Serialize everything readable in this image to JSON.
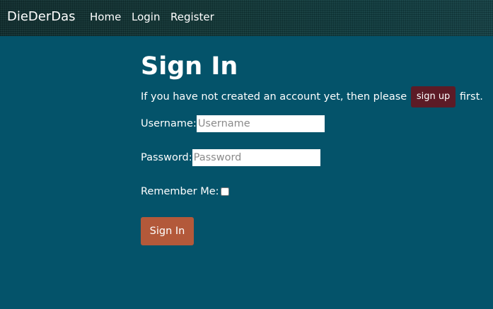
{
  "colors": {
    "page_background": "#04536a",
    "signup_button": "#5c1b26",
    "submit_button": "#b3593a"
  },
  "navbar": {
    "brand": "DieDerDas",
    "links": [
      {
        "label": "Home"
      },
      {
        "label": "Login"
      },
      {
        "label": "Register"
      }
    ]
  },
  "main": {
    "title": "Sign In",
    "intro_before": "If you have not created an account yet, then please",
    "signup_label": "sign up",
    "intro_after": "first.",
    "username": {
      "label": "Username:",
      "value": "",
      "placeholder": "Username"
    },
    "password": {
      "label": "Password:",
      "value": "",
      "placeholder": "Password"
    },
    "remember": {
      "label": "Remember Me:",
      "checked": false
    },
    "submit_label": "Sign In"
  }
}
